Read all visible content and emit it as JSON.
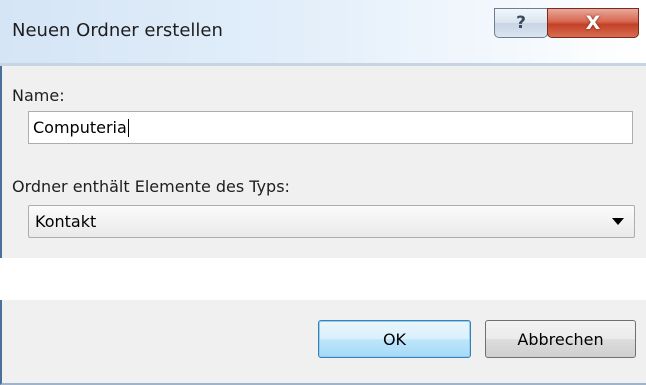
{
  "window": {
    "title": "Neuen Ordner erstellen",
    "help_icon": "help-icon",
    "help_label": "?",
    "close_icon": "close-icon",
    "close_label": "X"
  },
  "form": {
    "name_label": "Name:",
    "name_value": "Computeria",
    "type_label": "Ordner enthält Elemente des Typs:",
    "type_selected": "Kontakt",
    "dropdown_icon": "chevron-down-icon"
  },
  "buttons": {
    "ok_label": "OK",
    "cancel_label": "Abbrechen"
  }
}
